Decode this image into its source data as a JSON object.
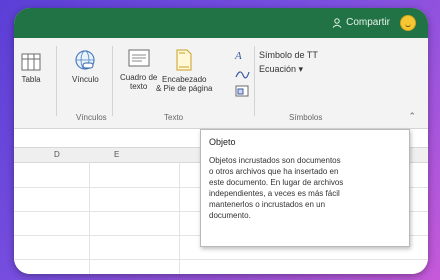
{
  "title_bar": {
    "share_label": "Compartir",
    "accent": "#217346"
  },
  "ribbon": {
    "tabla_label": "Tabla",
    "vinculo_label": "Vínculo",
    "cuadro_label_1": "Cuadro de",
    "cuadro_label_2": "texto",
    "encabezado_label_1": "Encabezado",
    "encabezado_label_2": "& Pie de página",
    "group_vinculos": "Vínculos",
    "group_texto": "Texto",
    "simbolo_label": "Símbolo de TT",
    "ecuacion_label": "Ecuación",
    "group_simbolos": "Símbolos"
  },
  "sheet": {
    "columns": [
      "D",
      "E"
    ]
  },
  "tooltip": {
    "title": "Objeto",
    "body": "Objetos incrustados son documentos\no otros archivos que ha insertado en\neste documento. En lugar de archivos\nindependientes, a veces es más fácil\nmantenerlos o incrustados en un\ndocumento."
  }
}
